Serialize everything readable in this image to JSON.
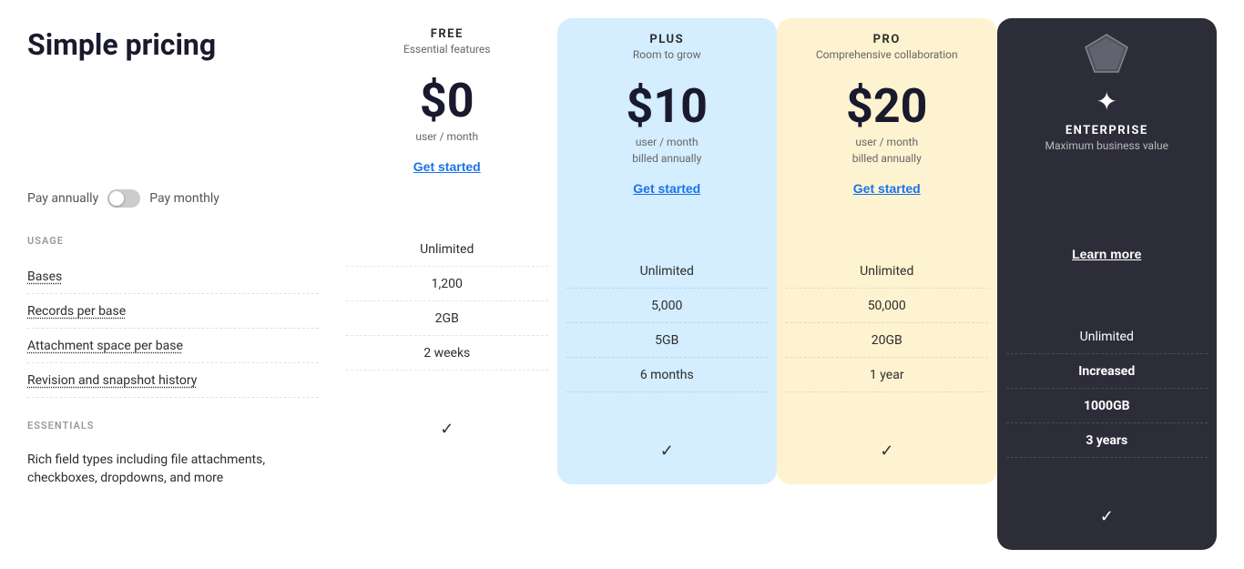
{
  "page": {
    "title": "Simple pricing"
  },
  "billing": {
    "pay_annually": "Pay annually",
    "pay_monthly": "Pay monthly"
  },
  "sections": {
    "usage_label": "USAGE",
    "essentials_label": "ESSENTIALS"
  },
  "features": {
    "bases": "Bases",
    "records_per_base": "Records per base",
    "attachment_space": "Attachment space per base",
    "revision_history": "Revision and snapshot history",
    "rich_field": "Rich field types including file attachments, checkboxes, dropdowns, and more"
  },
  "plans": {
    "free": {
      "name": "FREE",
      "tagline": "Essential features",
      "price": "$0",
      "billing": "user / month",
      "cta": "Get started",
      "bases": "Unlimited",
      "records": "1,200",
      "attachment": "2GB",
      "revision": "2 weeks",
      "rich_field": true
    },
    "plus": {
      "name": "PLUS",
      "tagline": "Room to grow",
      "price": "$10",
      "billing": "user / month\nbilled annually",
      "cta": "Get started",
      "bases": "Unlimited",
      "records": "5,000",
      "attachment": "5GB",
      "revision": "6 months",
      "rich_field": true
    },
    "pro": {
      "name": "PRO",
      "tagline": "Comprehensive collaboration",
      "price": "$20",
      "billing": "user / month\nbilled annually",
      "cta": "Get started",
      "bases": "Unlimited",
      "records": "50,000",
      "attachment": "20GB",
      "revision": "1 year",
      "rich_field": true
    },
    "enterprise": {
      "name": "ENTERPRISE",
      "tagline": "Maximum business value",
      "cta": "Learn more",
      "bases": "Unlimited",
      "records": "Increased",
      "attachment": "1000GB",
      "revision": "3 years",
      "rich_field": true
    }
  }
}
